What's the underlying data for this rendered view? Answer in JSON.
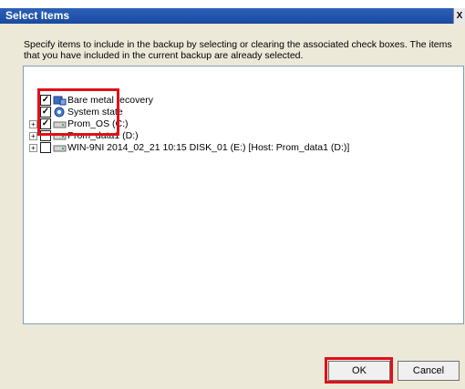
{
  "window": {
    "title": "Select Items",
    "close_glyph": "X"
  },
  "instructions": "Specify items to include in the backup by selecting or clearing the associated check boxes. The items that you have included in the current backup are already selected.",
  "tree": {
    "items": [
      {
        "label": "Bare metal recovery",
        "checked": true,
        "icon": "bare-metal-recovery-icon"
      },
      {
        "label": "System state",
        "checked": true,
        "icon": "system-state-icon"
      },
      {
        "label": "Prom_OS (C:)",
        "checked": true,
        "icon": "drive-icon"
      },
      {
        "label": "Prom_data1 (D:)",
        "checked": false,
        "icon": "drive-icon"
      },
      {
        "label": "WIN-9NI 2014_02_21 10:15 DISK_01 (E:) [Host: Prom_data1 (D:)]",
        "checked": false,
        "icon": "drive-icon"
      }
    ],
    "expand_glyph": "+",
    "check_glyph": "✓"
  },
  "buttons": {
    "ok": "OK",
    "cancel": "Cancel"
  },
  "colors": {
    "highlight": "#e0101a",
    "titlebar": "#1b4aa0"
  }
}
